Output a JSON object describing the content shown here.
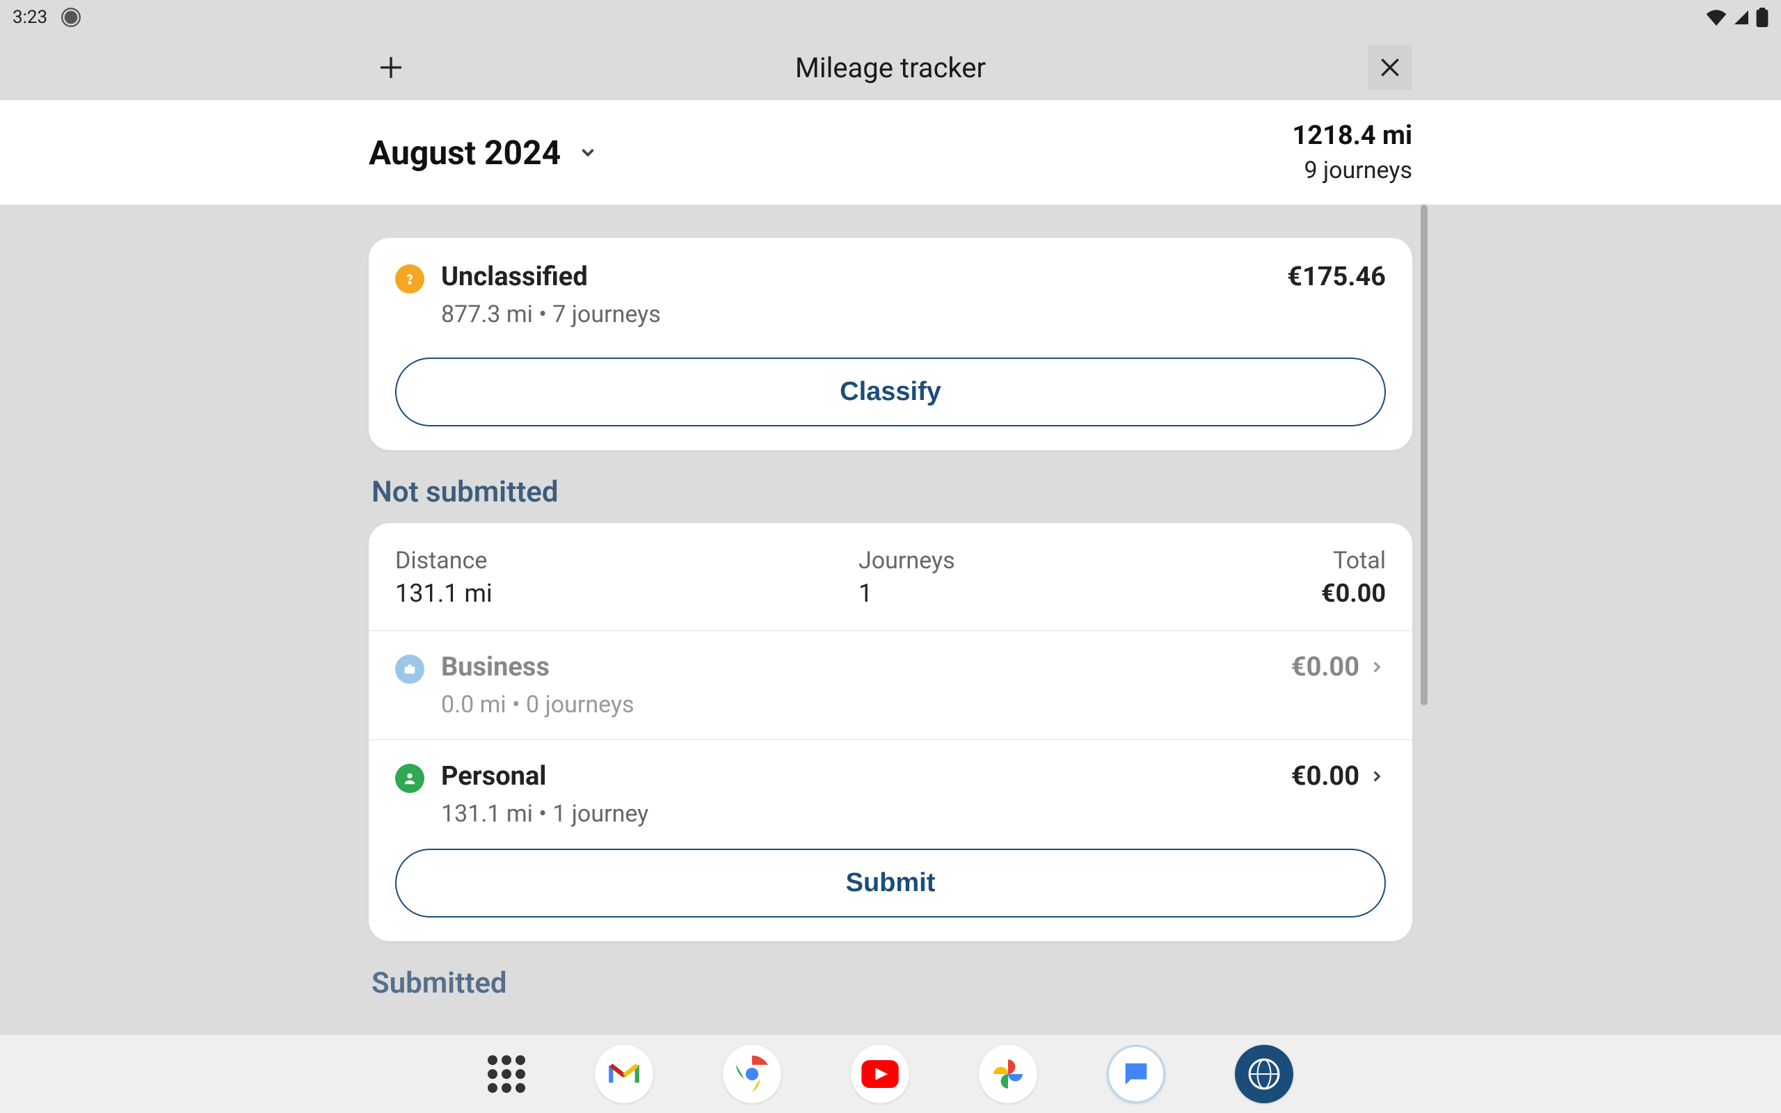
{
  "statusbar": {
    "time": "3:23"
  },
  "appbar": {
    "title": "Mileage tracker"
  },
  "summary": {
    "month": "August 2024",
    "miles": "1218.4 mi",
    "journeys": "9 journeys"
  },
  "unclassified": {
    "title": "Unclassified",
    "subtitle": "877.3 mi • 7 journeys",
    "amount": "€175.46",
    "button": "Classify"
  },
  "notSubmitted": {
    "heading": "Not submitted",
    "distance_label": "Distance",
    "distance_value": "131.1 mi",
    "journeys_label": "Journeys",
    "journeys_value": "1",
    "total_label": "Total",
    "total_value": "€0.00",
    "business": {
      "title": "Business",
      "subtitle": "0.0 mi • 0 journeys",
      "amount": "€0.00"
    },
    "personal": {
      "title": "Personal",
      "subtitle": "131.1 mi • 1 journey",
      "amount": "€0.00"
    },
    "submit_button": "Submit"
  },
  "submitted": {
    "heading": "Submitted"
  }
}
